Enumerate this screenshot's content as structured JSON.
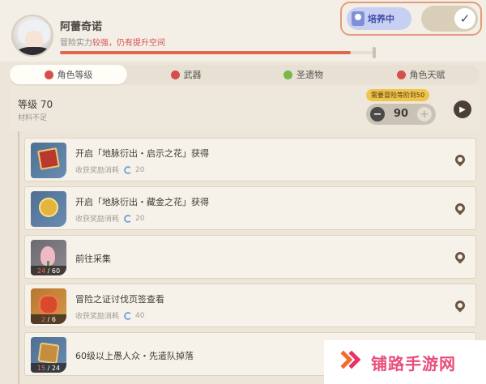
{
  "header": {
    "character_name": "阿蕾奇诺",
    "power_label": "冒险实力",
    "power_status": "较强，仍有提升空间",
    "progress_fraction": 0.92,
    "cultivate_label": "培养中",
    "check_glyph": "✓"
  },
  "tabs": [
    {
      "label": "角色等级",
      "status": "red"
    },
    {
      "label": "武器",
      "status": "red"
    },
    {
      "label": "圣遗物",
      "status": "green"
    },
    {
      "label": "角色天赋",
      "status": "red"
    }
  ],
  "level_panel": {
    "title": "等级 70",
    "subtitle": "材料不足",
    "requirement": "需要冒险等阶到50",
    "target_level": "90",
    "minus": "−",
    "plus": "+",
    "play_glyph": "▶"
  },
  "rows": [
    {
      "title": "开启「地脉衍出・启示之花」获得",
      "sub": "收获奖励消耗",
      "cost": "20",
      "icon": "book-icon",
      "count": null
    },
    {
      "title": "开启「地脉衍出・藏金之花」获得",
      "sub": "收获奖励消耗",
      "cost": "20",
      "icon": "mora-icon",
      "count": null
    },
    {
      "title": "前往采集",
      "sub": null,
      "cost": null,
      "icon": "flower-icon",
      "count_have": "24",
      "count_need": "60"
    },
    {
      "title": "冒险之证讨伐页签查看",
      "sub": "收获奖励消耗",
      "cost": "40",
      "icon": "gem-icon",
      "count_have": "2",
      "count_need": "6"
    },
    {
      "title": "60级以上愚人众・先遣队掉落",
      "sub": null,
      "cost": null,
      "icon": "chest-icon",
      "count_have": "15",
      "count_need": "24"
    }
  ],
  "watermark": {
    "text": "铺路手游网"
  },
  "colors": {
    "accent_red": "#d9534f",
    "progress": "#e0664e",
    "badge": "#f0c34a"
  }
}
